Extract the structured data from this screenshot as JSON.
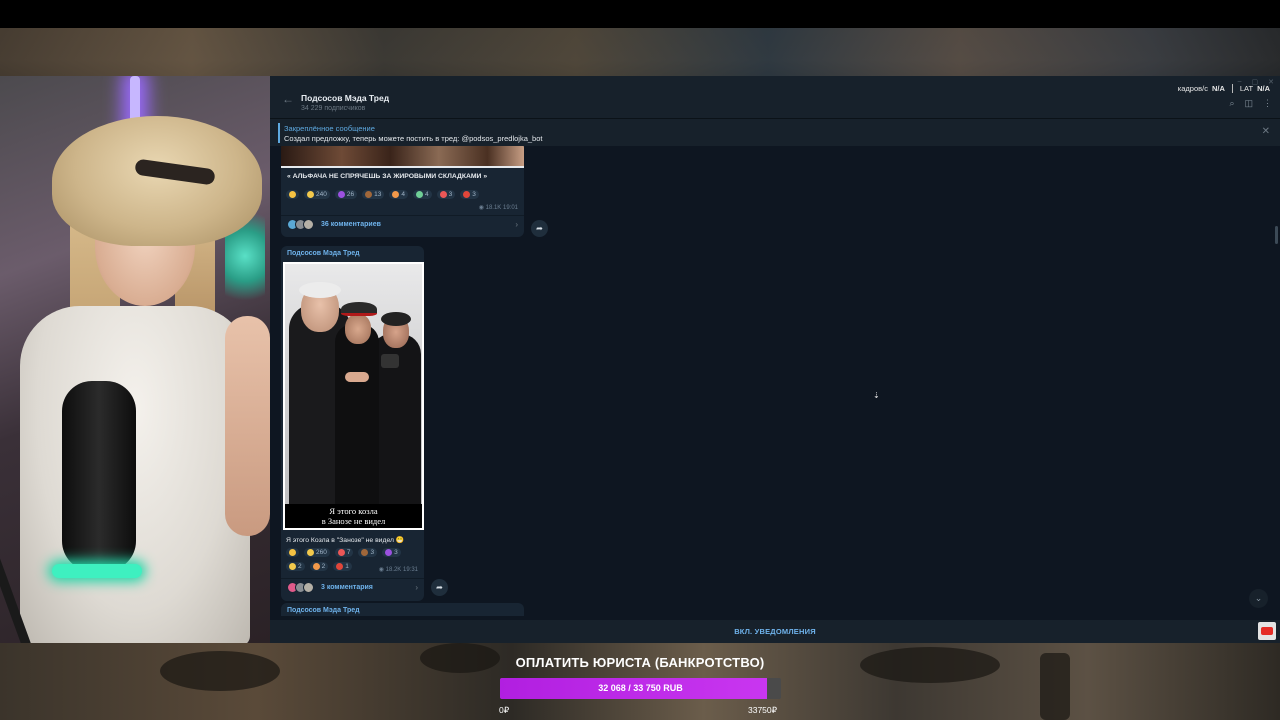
{
  "telegram": {
    "channel_title": "Подсосов Мэда Тред",
    "subscribers": "34 229 подписчиков",
    "stats": {
      "fps_label": "кадров/с",
      "fps_value": "N/A",
      "lat_label": "LAT",
      "lat_value": "N/A"
    },
    "pinned": {
      "title": "Закреплённое сообщение",
      "text": "Создал предложку, теперь можете постить в тред: @podsos_predlojka_bot"
    },
    "messages": [
      {
        "caption": "« АЛЬФАЧА НЕ СПРЯЧЕШЬ ЗА ЖИРОВЫМИ СКЛАДКАМИ »",
        "reactions": [
          {
            "emoji": "star-icon",
            "count": ""
          },
          {
            "emoji": "grin-icon",
            "count": "240"
          },
          {
            "emoji": "devil-icon",
            "count": "26"
          },
          {
            "emoji": "poop-icon",
            "count": "13"
          },
          {
            "emoji": "fire-icon",
            "count": "4"
          },
          {
            "emoji": "vomit-icon",
            "count": "4"
          },
          {
            "emoji": "heart-icon",
            "count": "3"
          },
          {
            "emoji": "angry-icon",
            "count": "3"
          }
        ],
        "views": "18.1K",
        "time": "19:01",
        "comments": "36 комментариев"
      },
      {
        "sender": "Подсосов Мэда Тред",
        "photo_caption_line1": "Я этого козла",
        "photo_caption_line2": "в Занозе не видел",
        "caption": "Я этого Козла в \"Занозе\" не видел 😁",
        "reactions_row1": [
          {
            "emoji": "star-icon",
            "count": ""
          },
          {
            "emoji": "grin-icon",
            "count": "260"
          },
          {
            "emoji": "heart-icon",
            "count": "7"
          },
          {
            "emoji": "poop-icon",
            "count": "3"
          },
          {
            "emoji": "devil-icon",
            "count": "3"
          }
        ],
        "reactions_row2": [
          {
            "emoji": "thumbs-up-icon",
            "count": "2"
          },
          {
            "emoji": "fire-icon",
            "count": "2"
          },
          {
            "emoji": "angry-icon",
            "count": "1"
          }
        ],
        "views": "18.2K",
        "time": "19:31",
        "comments": "3 комментария"
      },
      {
        "sender": "Подсосов Мэда Тред"
      }
    ],
    "bottom_button": "ВКЛ. УВЕДОМЛЕНИЯ"
  },
  "donation_goal": {
    "title": "ОПЛАТИТЬ ЮРИСТА (БАНКРОТСТВО)",
    "progress_text": "32 068 / 33 750 RUB",
    "current": 32068,
    "target": 33750,
    "min_label": "0₽",
    "max_label": "33750₽"
  },
  "colors": {
    "tg_bg": "#0e1621",
    "tg_panel": "#17212b",
    "tg_bubble": "#182533",
    "link_blue": "#6fb3ec",
    "goal_fill": "#c936f0"
  }
}
